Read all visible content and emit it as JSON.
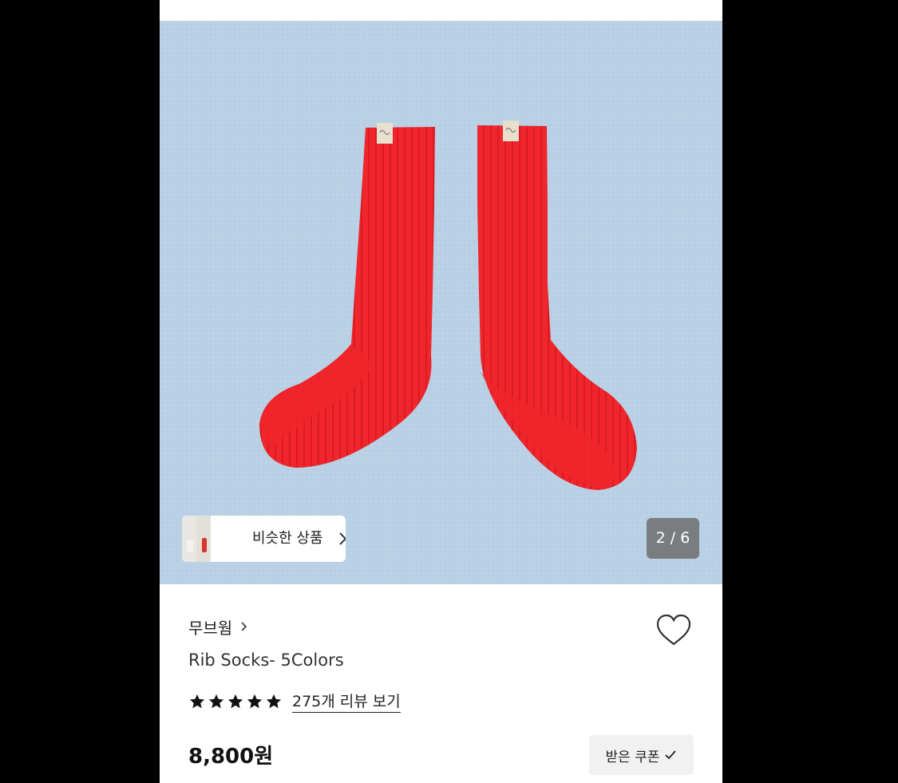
{
  "product_image": {
    "description_icon": "red-rib-socks-photo",
    "background_color": "#b9d0e5",
    "product_color": "#f0262c"
  },
  "similar": {
    "label": "비슷한 상품",
    "icon": "chevron-right-icon"
  },
  "gallery": {
    "indicator": "2 / 6",
    "current": 2,
    "total": 6
  },
  "brand": {
    "name": "무브웜",
    "icon": "chevron-right-icon"
  },
  "like": {
    "icon": "heart-outline-icon"
  },
  "product": {
    "title": "Rib Socks- 5Colors",
    "rating_stars": 5,
    "review_link": "275개 리뷰 보기",
    "price": "8,800원"
  },
  "coupon": {
    "label": "받은 쿠폰",
    "icon": "checkmark-icon"
  },
  "colors": {
    "text_primary": "#222222",
    "star": "#111111",
    "indicator_bg": "#6e6e6e"
  }
}
